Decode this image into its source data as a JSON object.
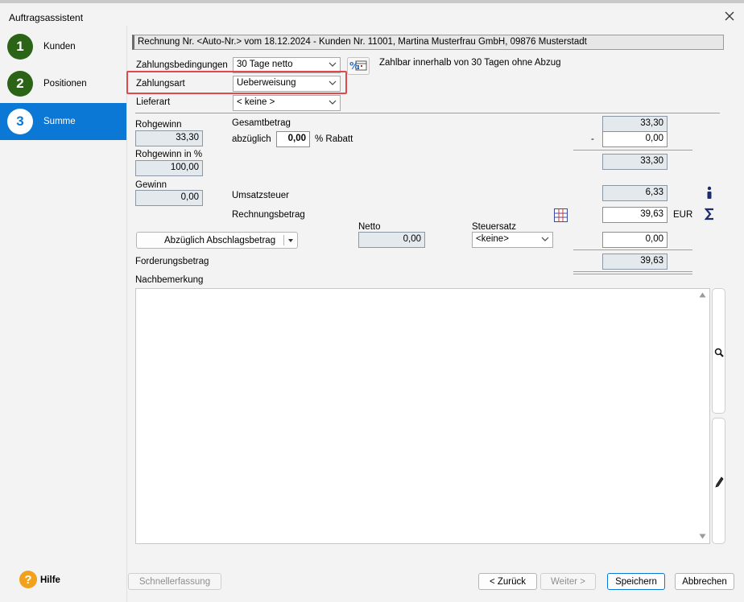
{
  "window": {
    "title": "Auftragsassistent"
  },
  "steps": [
    {
      "num": "1",
      "label": "Kunden"
    },
    {
      "num": "2",
      "label": "Positionen"
    },
    {
      "num": "3",
      "label": "Summe"
    }
  ],
  "info_line": "Rechnung Nr. <Auto-Nr.> vom 18.12.2024 - Kunden Nr. 11001, Martina Musterfrau GmbH, 09876 Musterstadt",
  "fields": {
    "zahlungsbedingungen_label": "Zahlungsbedingungen",
    "zahlungsbedingungen_value": "30 Tage netto",
    "zahlungsbedingungen_hint": "Zahlbar innerhalb von 30 Tagen ohne Abzug",
    "zahlungsart_label": "Zahlungsart",
    "zahlungsart_value": "Ueberweisung",
    "lieferart_label": "Lieferart",
    "lieferart_value": "< keine >"
  },
  "left_stats": {
    "rohgewinn_label": "Rohgewinn",
    "rohgewinn_value": "33,30",
    "rohgewinn_pct_label": "Rohgewinn in %",
    "rohgewinn_pct_value": "100,00",
    "gewinn_label": "Gewinn",
    "gewinn_value": "0,00"
  },
  "totals": {
    "gesamtbetrag_label": "Gesamtbetrag",
    "gesamtbetrag_value": "33,30",
    "abzueglich_label": "abzüglich",
    "rabatt_pct": "0,00",
    "rabatt_label": "% Rabatt",
    "minus_sign": "-",
    "rabatt_amount": "0,00",
    "subtotal_value": "33,30",
    "umsatzsteuer_label": "Umsatzsteuer",
    "umsatzsteuer_value": "6,33",
    "rechnungsbetrag_label": "Rechnungsbetrag",
    "rechnungsbetrag_value": "39,63",
    "currency": "EUR",
    "abschlag_button": "Abzüglich Abschlagsbetrag",
    "netto_label": "Netto",
    "netto_value": "0,00",
    "steuersatz_label": "Steuersatz",
    "steuersatz_value": "<keine>",
    "abschlag_value": "0,00",
    "forderungsbetrag_label": "Forderungsbetrag",
    "forderungsbetrag_value": "39,63"
  },
  "nachbemerkung_label": "Nachbemerkung",
  "footer": {
    "hilfe": "Hilfe",
    "help_glyph": "?",
    "schnellerfassung": "Schnellerfassung",
    "zurueck": "< Zurück",
    "weiter": "Weiter >",
    "speichern": "Speichern",
    "abbrechen": "Abbrechen"
  },
  "colors": {
    "accent": "#0a78d4",
    "step_done": "#2b6417",
    "highlight": "#e0484d",
    "help": "#f1a11e"
  }
}
